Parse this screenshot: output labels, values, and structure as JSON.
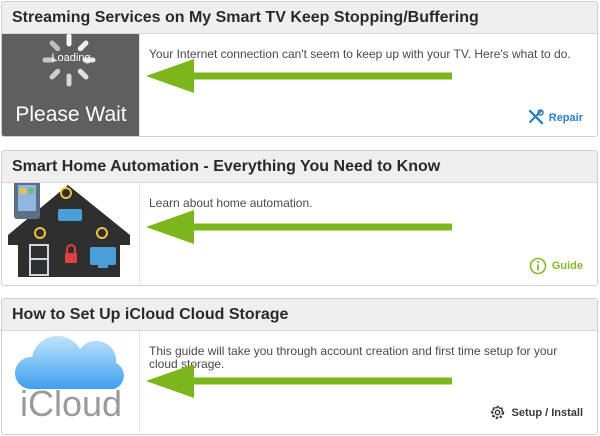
{
  "colors": {
    "card_header_bg": "#efefef",
    "title_text": "#2a2a2a",
    "body_text": "#4a4a4a",
    "link_blue": "#2f7fc1",
    "guide_green": "#86b82b",
    "arrow_green": "#7cb61a",
    "setup_gray": "#3a3a3a"
  },
  "cards": [
    {
      "title": "Streaming Services on My Smart TV Keep Stopping/Buffering",
      "thumbnail": {
        "loading_text": "Loading",
        "caption": "Please Wait",
        "icon": "loading-spinner"
      },
      "description": "Your Internet connection can't seem to keep up with your TV. Here's what to do.",
      "action": {
        "label": "Repair",
        "icon": "repair-tools-icon"
      }
    },
    {
      "title": "Smart Home Automation - Everything You Need to Know",
      "thumbnail": {
        "icon": "smart-home-illustration"
      },
      "description": "Learn about home automation.",
      "action": {
        "label": "Guide",
        "icon": "info-circle-icon"
      }
    },
    {
      "title": "How to Set Up iCloud Cloud Storage",
      "thumbnail": {
        "caption": "iCloud",
        "icon": "icloud-logo"
      },
      "description": "This guide will take you through account creation and first time setup for your cloud storage.",
      "action": {
        "label": "Setup / Install",
        "icon": "gear-icon"
      }
    }
  ]
}
